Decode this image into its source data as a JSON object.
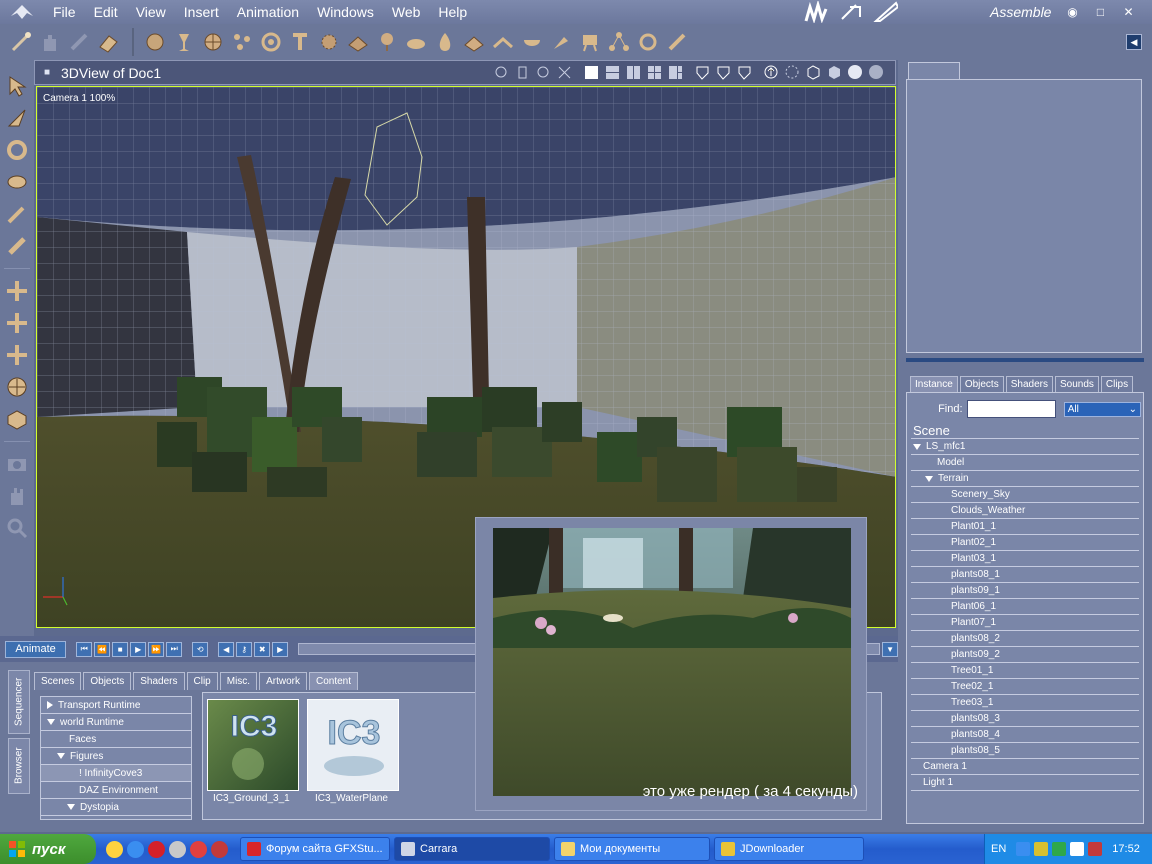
{
  "menu": {
    "items": [
      "File",
      "Edit",
      "View",
      "Insert",
      "Animation",
      "Windows",
      "Web",
      "Help"
    ]
  },
  "room": {
    "name": "Assemble"
  },
  "view": {
    "title": "3DView of Doc1",
    "camera_label": "Camera 1 100%"
  },
  "animation": {
    "animate_label": "Animate"
  },
  "browser": {
    "side_tabs": [
      "Sequencer",
      "Browser"
    ],
    "tabs": [
      "Scenes",
      "Objects",
      "Shaders",
      "Clip",
      "Misc.",
      "Artwork",
      "Content"
    ],
    "active_tab": "Content",
    "tree": [
      {
        "label": "Transport Runtime",
        "indent": 0,
        "toggle": "closed"
      },
      {
        "label": "world Runtime",
        "indent": 0,
        "toggle": "open"
      },
      {
        "label": "Faces",
        "indent": 1,
        "toggle": "none"
      },
      {
        "label": "Figures",
        "indent": 1,
        "toggle": "open"
      },
      {
        "label": "! InfinityCove3",
        "indent": 2,
        "toggle": "none"
      },
      {
        "label": "DAZ Environment",
        "indent": 2,
        "toggle": "none"
      },
      {
        "label": "Dystopia",
        "indent": 1,
        "toggle": "open"
      }
    ],
    "items": [
      {
        "label": "IC3_Ground_3_1",
        "logo": "IC3"
      },
      {
        "label": "IC3_WaterPlane",
        "logo": "IC3"
      }
    ]
  },
  "render": {
    "caption": "это уже рендер ( за 4 секунды)"
  },
  "right_panel": {
    "tabs": [
      "Instance",
      "Objects",
      "Shaders",
      "Sounds",
      "Clips"
    ],
    "active_tab": "Instance",
    "find_label": "Find:",
    "find_value": "",
    "filter_value": "All",
    "scene_title": "Scene",
    "scene_items": [
      {
        "label": "LS_mfc1",
        "level": 0,
        "toggle": "open"
      },
      {
        "label": "Model",
        "level": 1,
        "toggle": "none"
      },
      {
        "label": "Terrain",
        "level": 1,
        "toggle": "open"
      },
      {
        "label": "Scenery_Sky",
        "level": 2,
        "toggle": "none"
      },
      {
        "label": "Clouds_Weather",
        "level": 2,
        "toggle": "none"
      },
      {
        "label": "Plant01_1",
        "level": 2,
        "toggle": "none"
      },
      {
        "label": "Plant02_1",
        "level": 2,
        "toggle": "none"
      },
      {
        "label": "Plant03_1",
        "level": 2,
        "toggle": "none"
      },
      {
        "label": "plants08_1",
        "level": 2,
        "toggle": "none"
      },
      {
        "label": "plants09_1",
        "level": 2,
        "toggle": "none"
      },
      {
        "label": "Plant06_1",
        "level": 2,
        "toggle": "none"
      },
      {
        "label": "Plant07_1",
        "level": 2,
        "toggle": "none"
      },
      {
        "label": "plants08_2",
        "level": 2,
        "toggle": "none"
      },
      {
        "label": "plants09_2",
        "level": 2,
        "toggle": "none"
      },
      {
        "label": "Tree01_1",
        "level": 2,
        "toggle": "none"
      },
      {
        "label": "Tree02_1",
        "level": 2,
        "toggle": "none"
      },
      {
        "label": "Tree03_1",
        "level": 2,
        "toggle": "none"
      },
      {
        "label": "plants08_3",
        "level": 2,
        "toggle": "none"
      },
      {
        "label": "plants08_4",
        "level": 2,
        "toggle": "none"
      },
      {
        "label": "plants08_5",
        "level": 2,
        "toggle": "none"
      },
      {
        "label": "Camera 1",
        "level": 0,
        "toggle": "none"
      },
      {
        "label": "Light 1",
        "level": 0,
        "toggle": "none"
      }
    ]
  },
  "taskbar": {
    "start_label": "пуск",
    "tasks": [
      {
        "label": "Форум сайта GFXStu...",
        "color": "#d8262a"
      },
      {
        "label": "Carrara",
        "color": "#cfd6e6"
      },
      {
        "label": "Мои документы",
        "color": "#f2d36b"
      },
      {
        "label": "JDownloader",
        "color": "#e9c437"
      }
    ],
    "lang": "EN",
    "clock": "17:52"
  }
}
